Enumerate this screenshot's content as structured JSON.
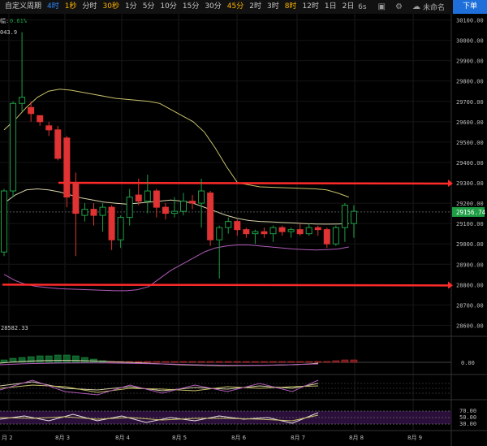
{
  "toolbar": {
    "timeframes": [
      {
        "label": "自定义周期",
        "state": "normal"
      },
      {
        "label": "4时",
        "state": "blue"
      },
      {
        "label": "1秒",
        "state": "active"
      },
      {
        "label": "分时",
        "state": "normal"
      },
      {
        "label": "30秒",
        "state": "active"
      },
      {
        "label": "1分",
        "state": "normal"
      },
      {
        "label": "5分",
        "state": "normal"
      },
      {
        "label": "10分",
        "state": "normal"
      },
      {
        "label": "15分",
        "state": "normal"
      },
      {
        "label": "30分",
        "state": "normal"
      },
      {
        "label": "45分",
        "state": "active"
      },
      {
        "label": "2时",
        "state": "normal"
      },
      {
        "label": "3时",
        "state": "normal"
      },
      {
        "label": "8时",
        "state": "active"
      },
      {
        "label": "12时",
        "state": "normal"
      },
      {
        "label": "1日",
        "state": "normal"
      },
      {
        "label": "2日",
        "state": "normal"
      }
    ],
    "refresh_label": "6s",
    "camera_icon": "camera-icon",
    "settings_icon": "settings-icon",
    "cloud_icon": "cloud-icon",
    "unnamed_label": "未命名",
    "order_label": "下单"
  },
  "chart": {
    "header_prefix": "幅:",
    "header_change": "0.61%",
    "high_label": "043.9",
    "low_label": "28582.33",
    "last_price": "29156.74",
    "macd_zero_label": "0.00",
    "price_axis": [
      "30100.00",
      "30000.00",
      "29900.00",
      "29800.00",
      "29700.00",
      "29600.00",
      "29500.00",
      "29400.00",
      "29300.00",
      "29200.00",
      "29100.00",
      "29000.00",
      "28900.00",
      "28800.00",
      "28700.00",
      "28600.00"
    ],
    "rsi_axis": [
      "70.00",
      "50.00",
      "30.00"
    ],
    "date_labels": [
      "月 2",
      "8月 3",
      "8月 4",
      "8月 5",
      "8月 6",
      "8月 7",
      "8月 8",
      "8月 9"
    ],
    "colors": {
      "up": "#1e9e45",
      "down": "#e03333",
      "upper_band": "#c8c06a",
      "mid_band": "#d8d2a8",
      "lower_band": "#b05ab8",
      "hline": "#ff2a2a",
      "price_tag": "#1e9e45",
      "header_change": "#1e9e45"
    }
  },
  "chart_data": {
    "type": "candlestick",
    "interval": "4h",
    "x_labels": [
      "8月 2",
      "8月 3",
      "8月 4",
      "8月 5",
      "8月 6",
      "8月 7",
      "8月 8",
      "8月 9"
    ],
    "y_range": [
      28550,
      30130
    ],
    "candles": [
      [
        28960,
        29260,
        29270,
        28940
      ],
      [
        29260,
        29690,
        29700,
        29230
      ],
      [
        29690,
        29720,
        30040,
        29650
      ],
      [
        29670,
        29640,
        29700,
        29600
      ],
      [
        29630,
        29600,
        29620,
        29580
      ],
      [
        29580,
        29560,
        29600,
        29530
      ],
      [
        29560,
        29420,
        29580,
        29410
      ],
      [
        29520,
        29230,
        29530,
        29180
      ],
      [
        29300,
        29150,
        29350,
        28940
      ],
      [
        29140,
        29170,
        29200,
        29110
      ],
      [
        29170,
        29140,
        29200,
        29090
      ],
      [
        29140,
        29180,
        29200,
        29060
      ],
      [
        29180,
        29020,
        29190,
        28970
      ],
      [
        29020,
        29130,
        29140,
        28980
      ],
      [
        29130,
        29230,
        29270,
        29090
      ],
      [
        29240,
        29210,
        29320,
        29190
      ],
      [
        29210,
        29260,
        29340,
        29150
      ],
      [
        29260,
        29180,
        29270,
        29130
      ],
      [
        29180,
        29150,
        29200,
        29120
      ],
      [
        29150,
        29160,
        29230,
        29130
      ],
      [
        29160,
        29210,
        29250,
        29140
      ],
      [
        29210,
        29200,
        29240,
        29170
      ],
      [
        29200,
        29260,
        29320,
        29080
      ],
      [
        29250,
        29020,
        29260,
        28990
      ],
      [
        29020,
        29080,
        29090,
        28830
      ],
      [
        29080,
        29110,
        29130,
        29050
      ],
      [
        29110,
        29070,
        29120,
        29040
      ],
      [
        29070,
        29050,
        29080,
        29030
      ],
      [
        29050,
        29060,
        29070,
        29000
      ],
      [
        29060,
        29050,
        29080,
        29030
      ],
      [
        29050,
        29080,
        29090,
        29010
      ],
      [
        29080,
        29060,
        29090,
        29040
      ],
      [
        29060,
        29070,
        29080,
        29030
      ],
      [
        29070,
        29050,
        29100,
        29040
      ],
      [
        29050,
        29080,
        29100,
        29040
      ],
      [
        29080,
        29070,
        29090,
        29040
      ],
      [
        29070,
        29000,
        29080,
        28980
      ],
      [
        29000,
        29080,
        29090,
        28990
      ],
      [
        29080,
        29190,
        29200,
        29010
      ],
      [
        29100,
        29160,
        29190,
        29030
      ]
    ],
    "bollinger_upper": [
      29560,
      29610,
      29670,
      29720,
      29750,
      29760,
      29755,
      29745,
      29735,
      29725,
      29715,
      29710,
      29705,
      29700,
      29690,
      29660,
      29630,
      29600,
      29550,
      29470,
      29380,
      29300,
      29290,
      29280,
      29278,
      29276,
      29274,
      29272,
      29270,
      29265,
      29250,
      29230
    ],
    "bollinger_mid": [
      29200,
      29240,
      29265,
      29270,
      29265,
      29255,
      29240,
      29225,
      29215,
      29205,
      29200,
      29195,
      29200,
      29205,
      29210,
      29215,
      29210,
      29200,
      29180,
      29160,
      29140,
      29125,
      29115,
      29110,
      29108,
      29105,
      29103,
      29100,
      29098,
      29097,
      29098,
      29100
    ],
    "bollinger_lower": [
      28850,
      28820,
      28800,
      28790,
      28785,
      28780,
      28778,
      28776,
      28774,
      28772,
      28770,
      28770,
      28775,
      28790,
      28830,
      28870,
      28900,
      28930,
      28960,
      28980,
      28990,
      28995,
      28995,
      28990,
      28985,
      28980,
      28975,
      28972,
      28970,
      28972,
      28975,
      28985
    ],
    "horizontal_lines": [
      29300,
      28800
    ],
    "last_price": 29156.74
  }
}
